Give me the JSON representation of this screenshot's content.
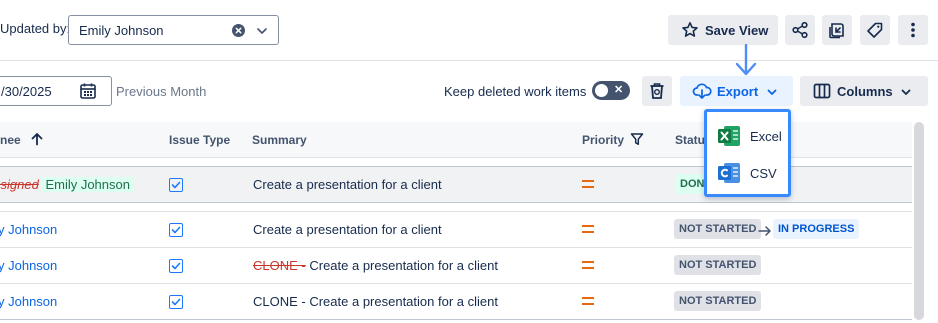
{
  "filters": {
    "updated_by_label": "Updated by:",
    "updated_by_value": "Emily Johnson",
    "date_value": "/30/2025",
    "preset_label": "Previous Month"
  },
  "toolbar": {
    "save_view_label": "Save View",
    "keep_deleted_label": "Keep deleted work items",
    "keep_deleted_toggle": "off",
    "export_label": "Export",
    "columns_label": "Columns"
  },
  "export_menu": {
    "items": [
      {
        "label": "Excel",
        "icon": "excel-icon"
      },
      {
        "label": "CSV",
        "icon": "csv-icon"
      }
    ]
  },
  "table": {
    "headers": {
      "assignee": "nee",
      "issue_type": "Issue Type",
      "summary": "Summary",
      "priority": "Priority",
      "status": "Status"
    },
    "sort": "ascending",
    "rows": [
      {
        "assignee_old": "ssigned",
        "assignee_new": "Emily Johnson",
        "summary": "Create a presentation for a client",
        "priority": "Medium",
        "status": "DONE"
      },
      {
        "assignee": "y Johnson",
        "summary": "Create a presentation for a client",
        "priority": "Medium",
        "status_from": "NOT STARTED",
        "status_to": "IN PROGRESS"
      },
      {
        "assignee": "y Johnson",
        "summary_removed": "CLONE -",
        "summary": " Create a presentation for a client",
        "priority": "Medium",
        "status": "NOT STARTED"
      },
      {
        "assignee": "y Johnson",
        "summary": "CLONE - Create a presentation for a client",
        "priority": "Medium",
        "status": "NOT STARTED"
      }
    ]
  },
  "colors": {
    "accent": "#0c66e4",
    "annotation_arrow": "#4c8df6",
    "priority_medium": "#e56910",
    "removed_text": "#c9372c",
    "added_highlight": "#dcfff1"
  }
}
